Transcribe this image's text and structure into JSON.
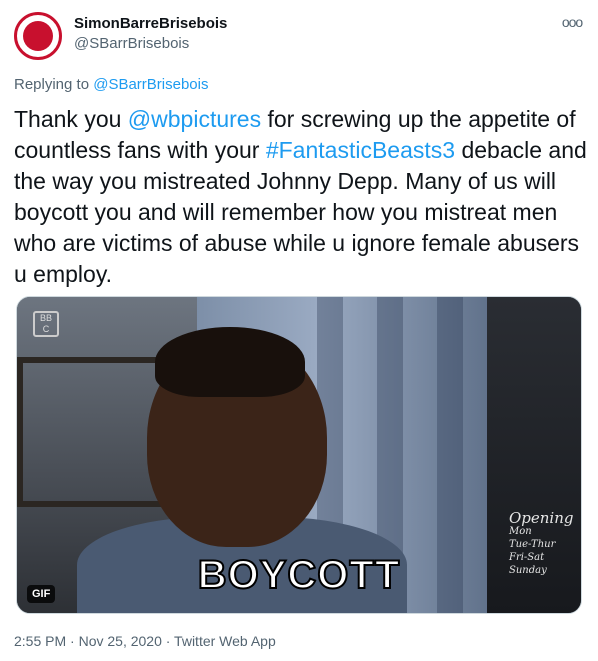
{
  "author": {
    "display_name": "SimonBarreBrisebois",
    "handle": "@SBarrBrisebois",
    "avatar_icon": "maple-leaf-logo"
  },
  "more_label": "ooo",
  "reply": {
    "prefix": "Replying to ",
    "target": "@SBarrBrisebois"
  },
  "body": {
    "t1": "Thank you ",
    "mention": "@wbpictures",
    "t2": " for screwing up the appetite of countless fans with your ",
    "hashtag": "#FantasticBeasts3",
    "t3": " debacle and the way you mistreated Johnny Depp. Many of us will boycott you and will remember how you mistreat men who are victims of abuse while u ignore female abusers u employ."
  },
  "media": {
    "caption": "BOYCOTT",
    "badge": "GIF",
    "sign_lines": [
      "Opening",
      "Mon",
      "Tue-Thur",
      "Fri-Sat",
      "Sunday"
    ]
  },
  "meta": {
    "text": "2:55 PM · Nov 25, 2020 · Twitter Web App"
  },
  "colors": {
    "link": "#1d9bf0",
    "secondary_text": "#536471",
    "avatar_accent": "#c8102e"
  }
}
